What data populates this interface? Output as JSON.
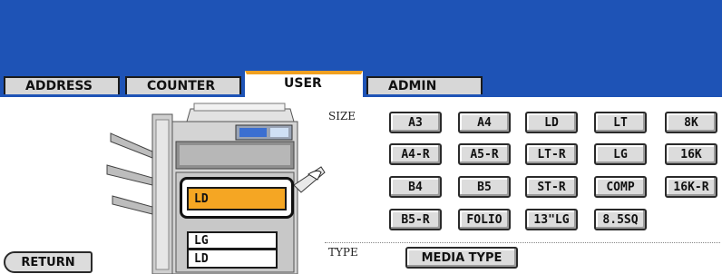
{
  "tabs": [
    {
      "label": "ADDRESS",
      "active": false
    },
    {
      "label": "COUNTER",
      "active": false
    },
    {
      "label": "USER",
      "active": true
    },
    {
      "label": "ADMIN",
      "active": false
    }
  ],
  "size_section": {
    "label": "SIZE",
    "rows": [
      [
        "A3",
        "A4",
        "LD",
        "LT",
        "8K"
      ],
      [
        "A4-R",
        "A5-R",
        "LT-R",
        "LG",
        "16K"
      ],
      [
        "B4",
        "B5",
        "ST-R",
        "COMP",
        "16K-R"
      ],
      [
        "B5-R",
        "FOLIO",
        "13\"LG",
        "8.5SQ"
      ]
    ]
  },
  "type_section": {
    "label": "TYPE",
    "button": "MEDIA TYPE"
  },
  "trays": {
    "selected": "LD",
    "list": [
      "LG",
      "LD"
    ]
  },
  "return_label": "RETURN",
  "colors": {
    "banner": "#1e53b6",
    "active_tab_accent": "#f0a020",
    "selected_tray": "#f5a623"
  }
}
